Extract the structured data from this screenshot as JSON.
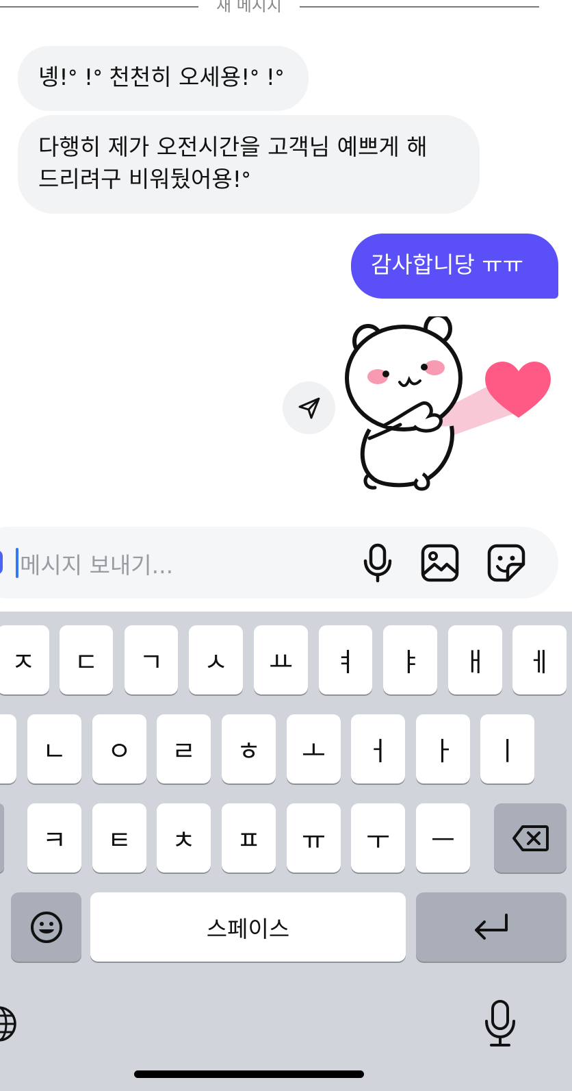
{
  "divider": {
    "label": "새 메시지"
  },
  "messages": [
    {
      "side": "left",
      "text": "녱!ᐤ !ᐤ 천천히 오세용!ᐤ !ᐤ"
    },
    {
      "side": "left",
      "lines": [
        "다행히 제가 오전시간을 고객님 예쁘게 해",
        "드리려구 비워뒀어용!ᐤ"
      ]
    },
    {
      "side": "right",
      "text": "감사합니당 ㅠㅠ"
    }
  ],
  "sticker": {
    "name": "bear-heart-sticker"
  },
  "composer": {
    "placeholder": "메시지 보내기...",
    "icons": [
      "microphone-icon",
      "image-icon",
      "sticker-icon"
    ]
  },
  "keyboard": {
    "row1": [
      "ㅈ",
      "ㄷ",
      "ㄱ",
      "ㅅ",
      "ㅛ",
      "ㅕ",
      "ㅑ",
      "ㅐ",
      "ㅔ"
    ],
    "row2": [
      "ㄴ",
      "ㅇ",
      "ㄹ",
      "ㅎ",
      "ㅗ",
      "ㅓ",
      "ㅏ",
      "ㅣ"
    ],
    "row3": [
      "ㅋ",
      "ㅌ",
      "ㅊ",
      "ㅍ",
      "ㅠ",
      "ㅜ",
      "ㅡ"
    ],
    "space_label": "스페이스"
  },
  "colors": {
    "accent": "#5b50f7",
    "bubble_gray": "#f2f3f5",
    "keyboard_bg": "#d1d4db"
  }
}
